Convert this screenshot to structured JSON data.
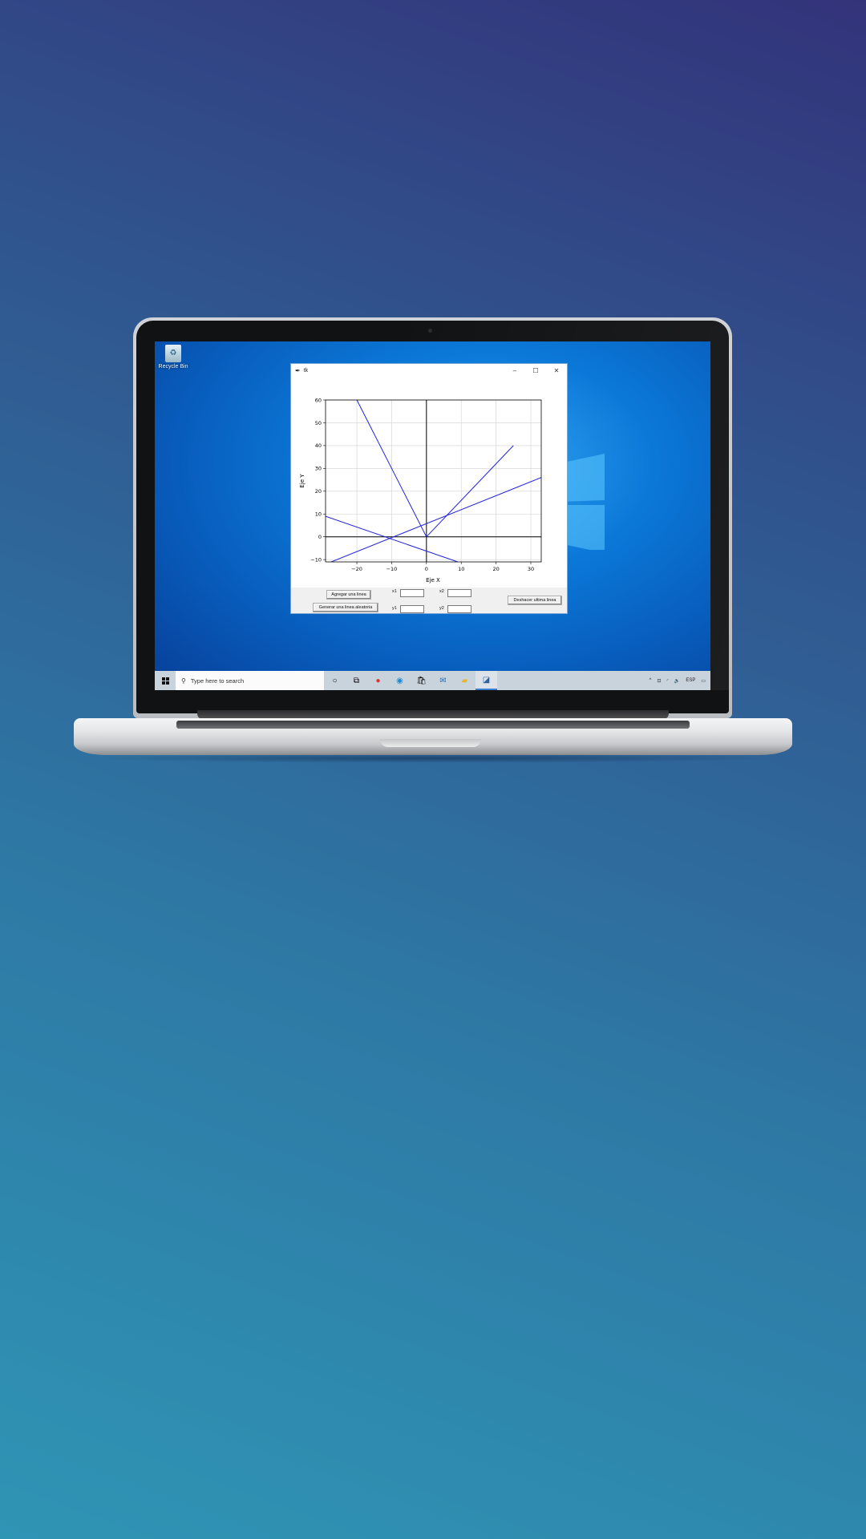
{
  "desktop": {
    "icon_label": "Recycle Bin"
  },
  "window": {
    "title": "tk",
    "minimize": "–",
    "maximize": "☐",
    "close": "✕"
  },
  "controls": {
    "add_line": "Agregar una linea",
    "random_line": "Generar una linea aleatoria",
    "undo_line": "Deshacer ultima linea",
    "x1_label": "x1",
    "y1_label": "y1",
    "x2_label": "x2",
    "y2_label": "y2",
    "x1_value": "",
    "y1_value": "",
    "x2_value": "",
    "y2_value": ""
  },
  "taskbar": {
    "search_placeholder": "Type here to search",
    "language": "ESP"
  },
  "chart_data": {
    "type": "line",
    "title": "",
    "xlabel": "Eje X",
    "ylabel": "Eje Y",
    "xlim": [
      -29,
      33
    ],
    "ylim": [
      -11,
      60
    ],
    "xticks": [
      -20,
      -10,
      0,
      10,
      20,
      30
    ],
    "yticks": [
      -10,
      0,
      10,
      20,
      30,
      40,
      50,
      60
    ],
    "grid": true,
    "line_color": "#2020e0",
    "axis_lines_color": "#000000",
    "series": [
      {
        "x": [
          -20,
          0
        ],
        "y": [
          60,
          0
        ]
      },
      {
        "x": [
          0,
          25
        ],
        "y": [
          0,
          40
        ]
      },
      {
        "x": [
          -29,
          33
        ],
        "y": [
          -12,
          26
        ]
      },
      {
        "x": [
          -29,
          9
        ],
        "y": [
          9,
          -11
        ]
      }
    ]
  }
}
